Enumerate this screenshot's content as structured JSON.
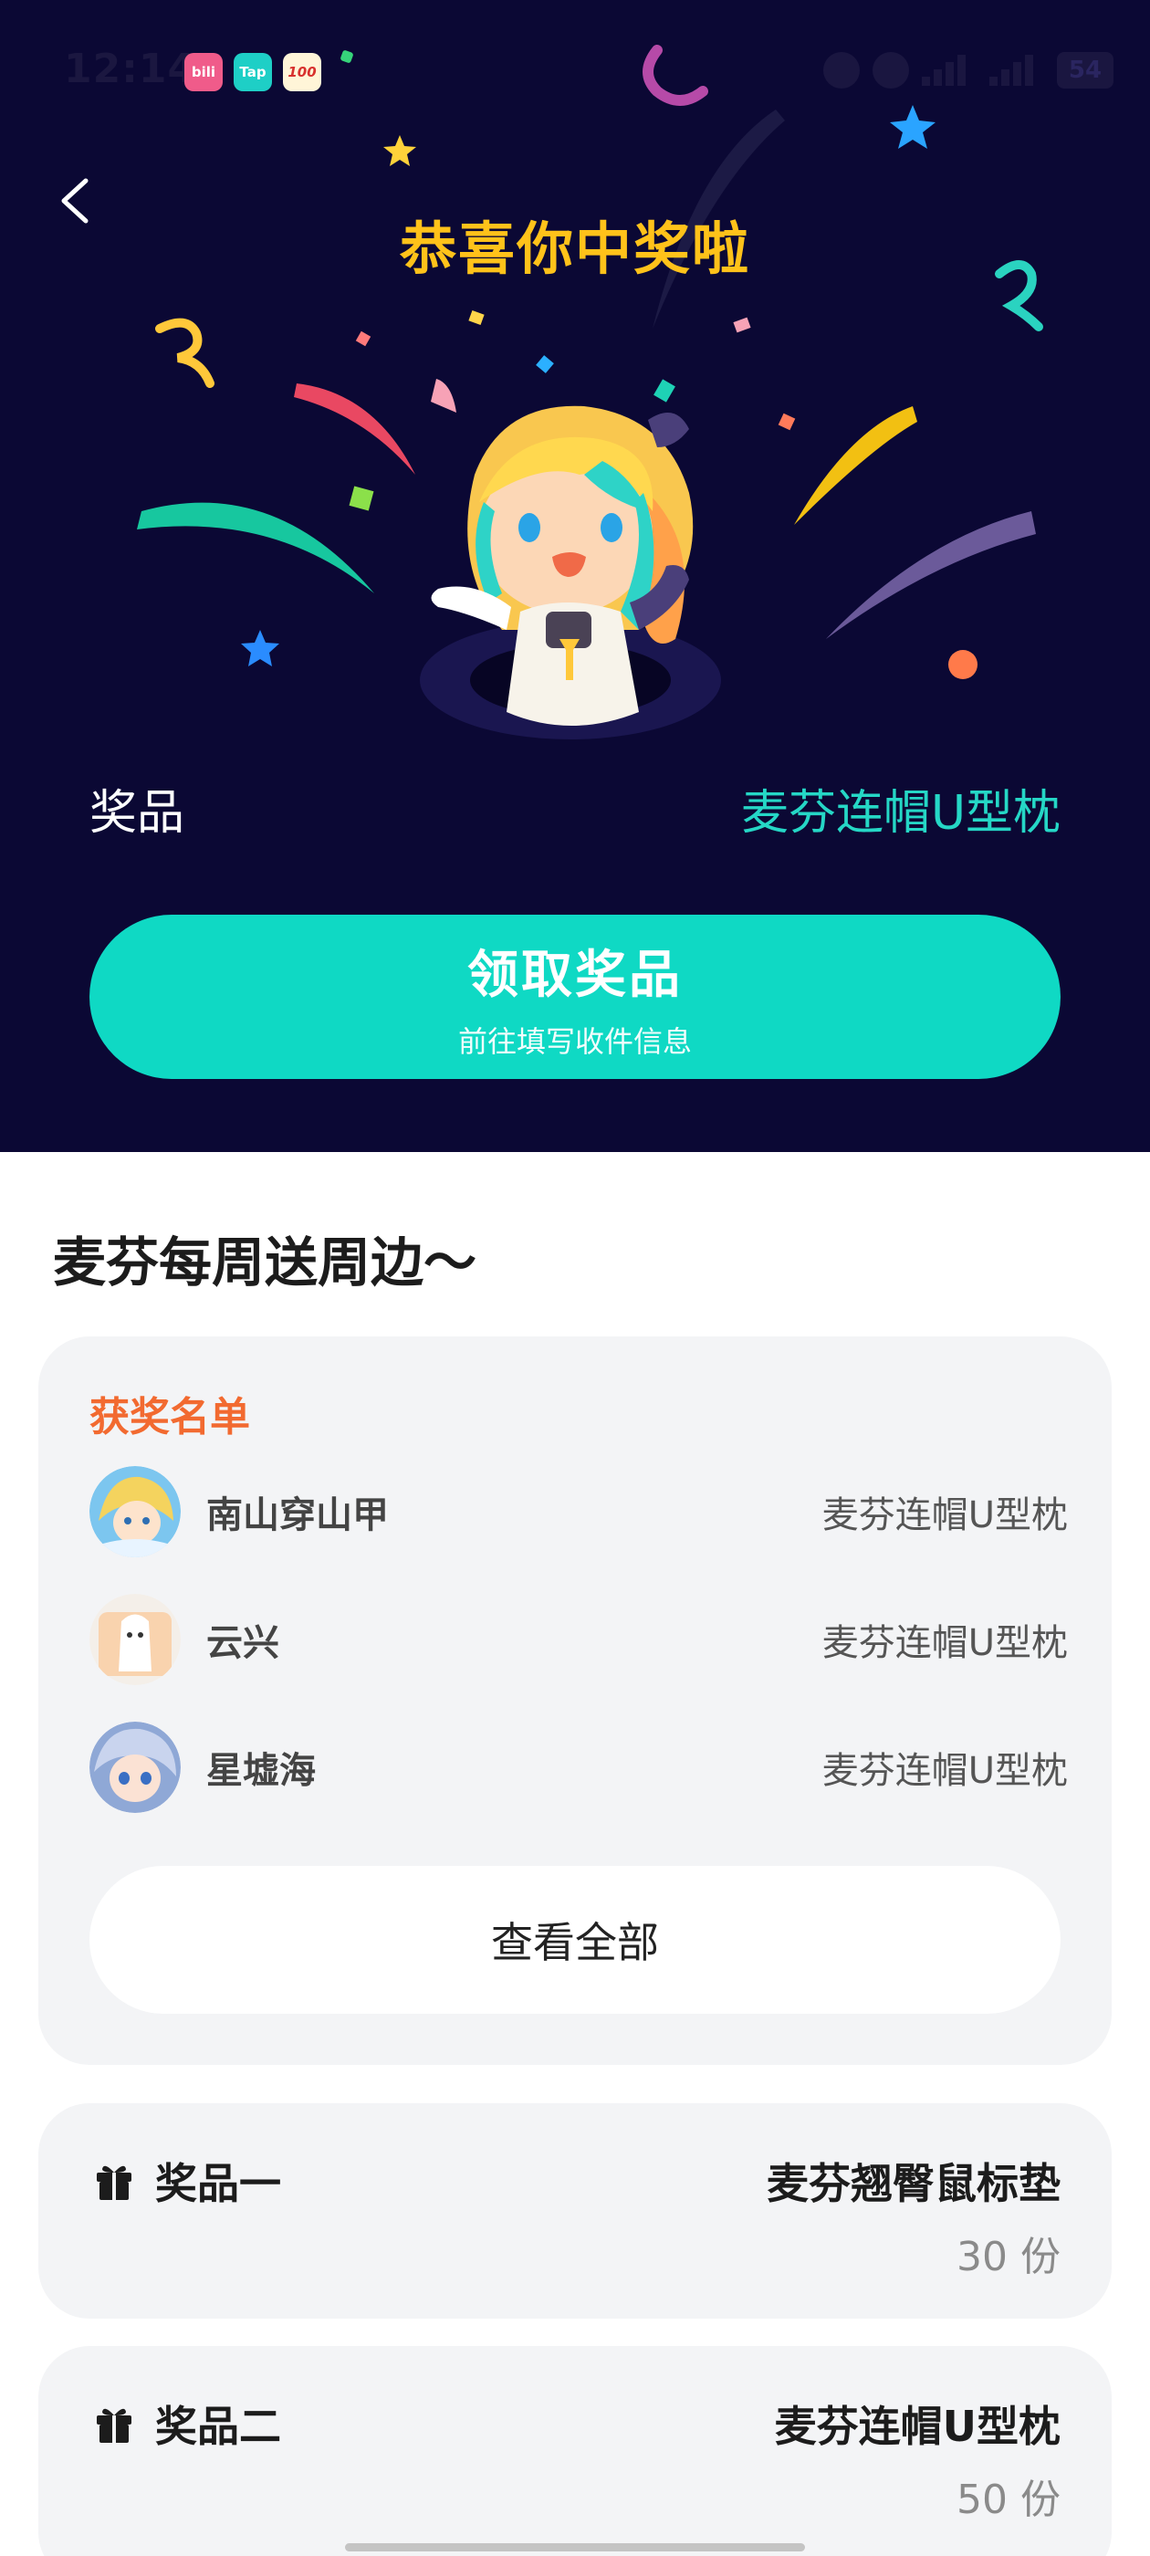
{
  "status_bar": {
    "time": "12:14",
    "app_icons": [
      "bilibili",
      "Tap",
      "100"
    ],
    "battery": "54"
  },
  "header": {
    "title": "恭喜你中奖啦"
  },
  "prize": {
    "label": "奖品",
    "value": "麦芬连帽U型枕"
  },
  "claim_button": {
    "label": "领取奖品",
    "sublabel": "前往填写收件信息"
  },
  "event": {
    "title": "麦芬每周送周边～"
  },
  "winners": {
    "heading": "获奖名单",
    "rows": [
      {
        "name": "南山穿山甲",
        "prize": "麦芬连帽U型枕"
      },
      {
        "name": "云兴",
        "prize": "麦芬连帽U型枕"
      },
      {
        "name": "星墟海",
        "prize": "麦芬连帽U型枕"
      }
    ],
    "view_all_label": "查看全部"
  },
  "prize_list": [
    {
      "name": "奖品一",
      "item": "麦芬翘臀鼠标垫",
      "count": "30 份"
    },
    {
      "name": "奖品二",
      "item": "麦芬连帽U型枕",
      "count": "50 份"
    }
  ],
  "colors": {
    "hero_bg": "#0b0834",
    "title_yellow": "#ffc21a",
    "accent_teal": "#0fd9c4",
    "prize_teal": "#25d7c6",
    "winners_orange": "#f26a30",
    "card_bg": "#f3f4f6"
  }
}
